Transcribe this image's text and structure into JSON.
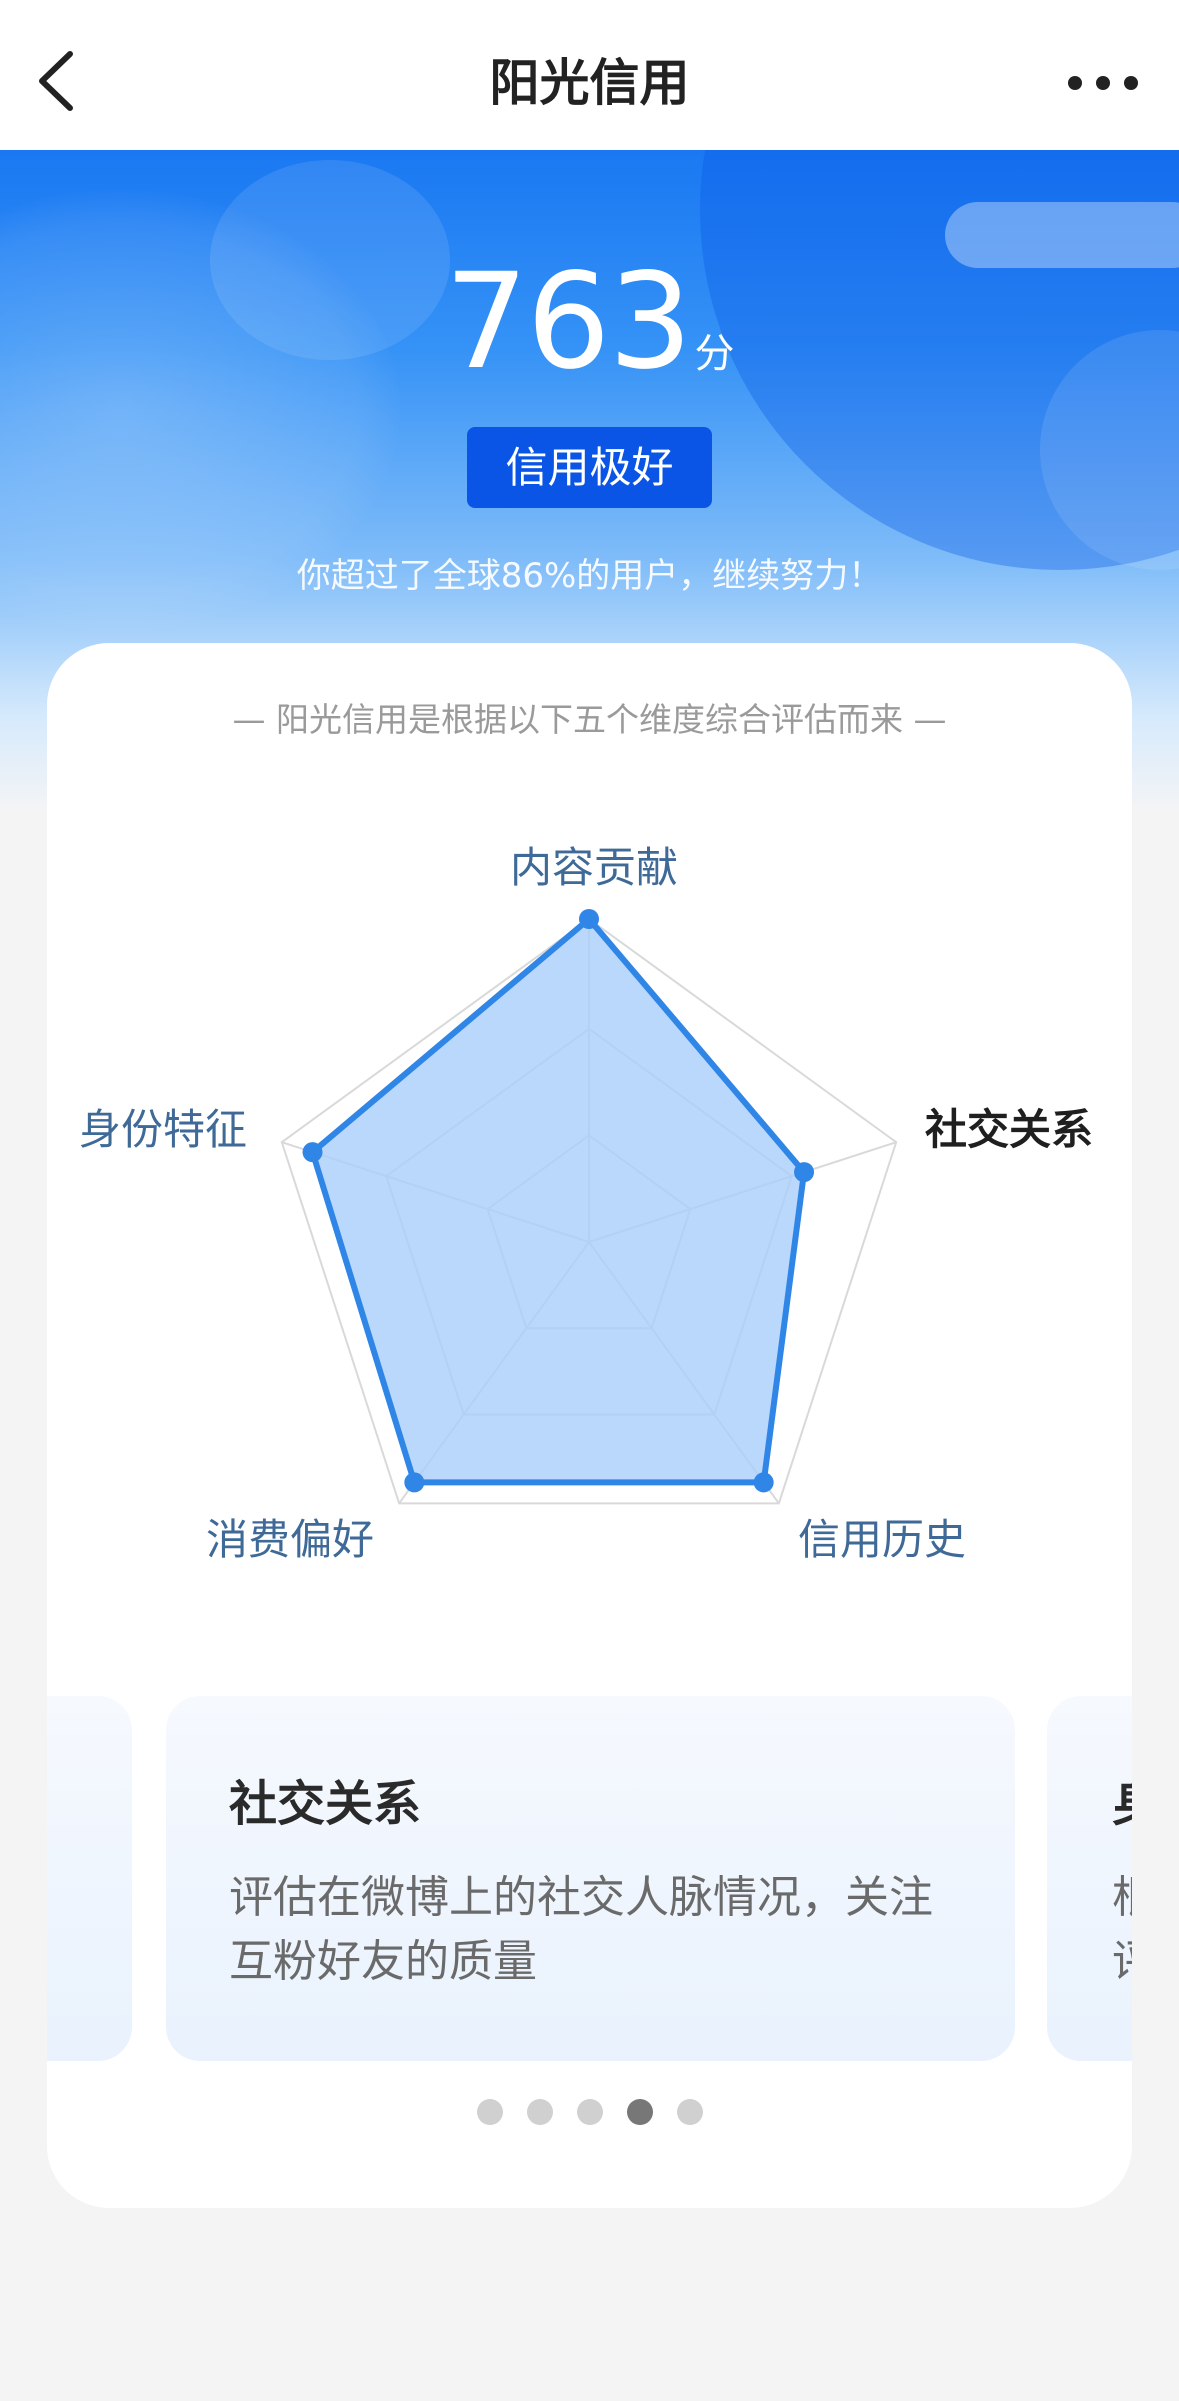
{
  "header": {
    "title": "阳光信用"
  },
  "hero": {
    "score": "763",
    "score_unit": "分",
    "level": "信用极好",
    "rank_text": "你超过了全球86%的用户，继续努力！"
  },
  "card": {
    "subtitle": "— 阳光信用是根据以下五个维度综合评估而来 —",
    "radar": {
      "dimensions": [
        "内容贡献",
        "社交关系",
        "信用历史",
        "消费偏好",
        "身份特征"
      ],
      "values": [
        1.0,
        0.7,
        0.92,
        0.92,
        0.9
      ],
      "active_index": 1,
      "colors": {
        "fill": "#a9cdfb",
        "stroke": "#2f86e6",
        "grid": "#d9d9d9"
      }
    },
    "carousel": {
      "current": {
        "title": "社交关系",
        "description": "评估在微博上的社交人脉情况，关注互粉好友的质量"
      },
      "next_peek": {
        "title": "身",
        "description": "根\n评"
      },
      "active_page": 3,
      "page_count": 5
    }
  }
}
